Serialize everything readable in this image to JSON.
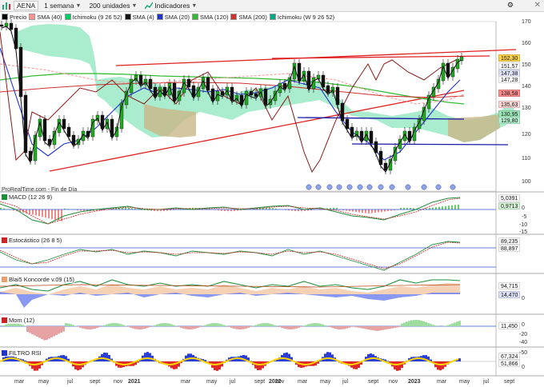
{
  "toolbar": {
    "symbol": "AENA",
    "interval": "1 semana",
    "units": "200 unidades",
    "indicators_label": "Indicadores"
  },
  "legend": [
    {
      "label": "Precio",
      "color": "#000000"
    },
    {
      "label": "SMA (40)",
      "color": "#ff9090"
    },
    {
      "label": "Ichimoku (9 26 52)",
      "color": "#00cc66"
    },
    {
      "label": "SMA (4)",
      "color": "#111111"
    },
    {
      "label": "SMA (20)",
      "color": "#2233cc"
    },
    {
      "label": "SMA (120)",
      "color": "#33bb33"
    },
    {
      "label": "SMA (200)",
      "color": "#cc3333"
    },
    {
      "label": "Ichimoku (W 9 26 52)",
      "color": "#00aa88"
    }
  ],
  "price_axis": [
    "170",
    "160",
    "150",
    "140",
    "130",
    "120",
    "110",
    "100"
  ],
  "price_tags": [
    {
      "value": "152,30",
      "bg": "#ffd24a"
    },
    {
      "value": "151,57",
      "bg": "#ffffff"
    },
    {
      "value": "147,38",
      "bg": "#dfe3ff"
    },
    {
      "value": "147,28",
      "bg": "#ffffff"
    },
    {
      "value": "138,58",
      "bg": "#ff8c8c"
    },
    {
      "value": "135,63",
      "bg": "#ffd8d8"
    },
    {
      "value": "130,95",
      "bg": "#9be7b8"
    },
    {
      "value": "129,80",
      "bg": "#b6f1d0"
    }
  ],
  "watermark": "ProRealTime.com - Fin de Día",
  "macd": {
    "label": "MACD (12 26 9)",
    "axis": [
      "0",
      "-5",
      "-10",
      "-15"
    ],
    "tags": [
      {
        "value": "5,0391",
        "bg": "#ffffff"
      },
      {
        "value": "0,9713",
        "bg": "#d6f5d6"
      }
    ]
  },
  "stoch": {
    "label": "Estocástico (26 8 5)",
    "tags": [
      {
        "value": "89,235",
        "bg": "#ffffff"
      },
      {
        "value": "88,897",
        "bg": "#ffffff"
      }
    ]
  },
  "blai": {
    "label": "Blai5 Koncorde v.09 (15)",
    "axis": [
      "0"
    ],
    "tags": [
      {
        "value": "94,715",
        "bg": "#ffffff"
      },
      {
        "value": "14,470",
        "bg": "#dfe3ff"
      }
    ]
  },
  "mom": {
    "label": "Mom (12)",
    "axis": [
      "0",
      "-20",
      "-40"
    ],
    "tags": [
      {
        "value": "11,450",
        "bg": "#ffffff"
      }
    ]
  },
  "rsi": {
    "label": "FILTRO RSI",
    "axis": [
      "-50",
      "0"
    ],
    "tags": [
      {
        "value": "67,324",
        "bg": "#ffffff"
      },
      {
        "value": "51,866",
        "bg": "#ffffff"
      }
    ]
  },
  "x_axis": [
    "mar",
    "may",
    "jul",
    "sept",
    "nov",
    "2021",
    "mar",
    "may",
    "jul",
    "sept",
    "nov",
    "2022",
    "mar",
    "may",
    "jul",
    "sept",
    "nov",
    "2023",
    "mar",
    "may",
    "jul",
    "sept"
  ]
}
